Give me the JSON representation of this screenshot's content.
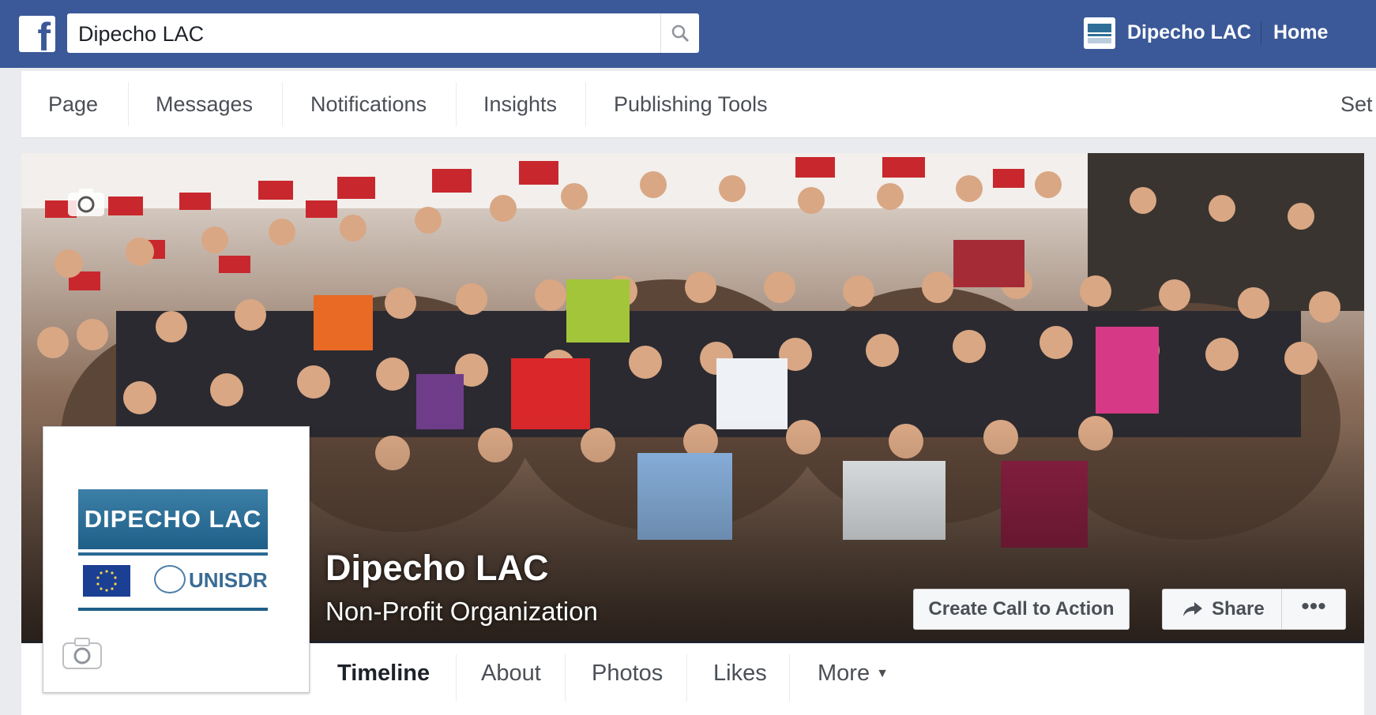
{
  "topbar": {
    "search_value": "Dipecho LAC",
    "page_name": "Dipecho LAC",
    "home_label": "Home",
    "brand_color": "#3b5998"
  },
  "admin_nav": {
    "items": [
      "Page",
      "Messages",
      "Notifications",
      "Insights",
      "Publishing Tools"
    ],
    "settings_partial": "Set"
  },
  "cover": {
    "page_title": "Dipecho LAC",
    "page_category": "Non-Profit Organization",
    "cta_label": "Create Call to Action",
    "share_label": "Share",
    "more_label": "•••"
  },
  "profile": {
    "logo_text": "DIPECHO LAC",
    "partner_text": "UNISDR"
  },
  "tabs": {
    "items": [
      "Timeline",
      "About",
      "Photos",
      "Likes",
      "More"
    ],
    "active": "Timeline"
  },
  "icons": [
    "facebook-logo-icon",
    "search-icon",
    "camera-icon",
    "share-arrow-icon",
    "more-dots-icon",
    "caret-down-icon"
  ]
}
